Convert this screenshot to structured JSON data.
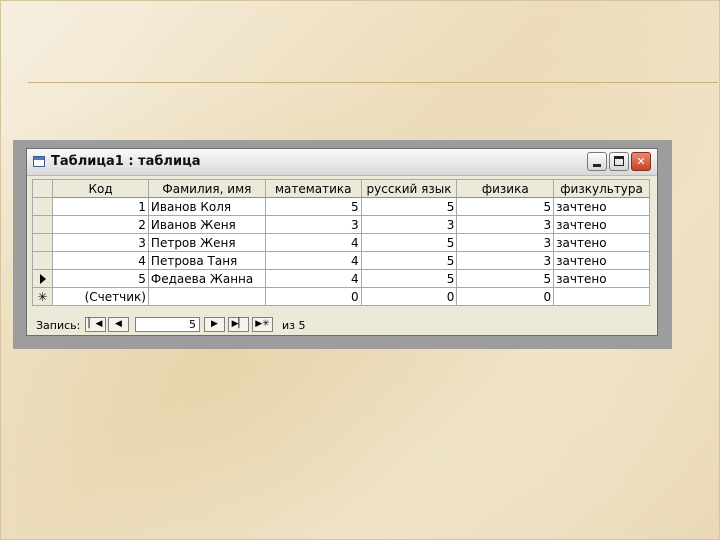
{
  "window": {
    "title": "Таблица1 : таблица",
    "close_glyph": "✕"
  },
  "table": {
    "columns": [
      "Код",
      "Фамилия, имя",
      "математика",
      "русский язык",
      "физика",
      "физкультура"
    ],
    "rows": [
      {
        "code": "1",
        "name": "Иванов Коля",
        "math": "5",
        "russian": "5",
        "physics": "5",
        "pe": "зачтено"
      },
      {
        "code": "2",
        "name": "Иванов Женя",
        "math": "3",
        "russian": "3",
        "physics": "3",
        "pe": "зачтено"
      },
      {
        "code": "3",
        "name": "Петров Женя",
        "math": "4",
        "russian": "5",
        "physics": "3",
        "pe": "зачтено"
      },
      {
        "code": "4",
        "name": "Петрова Таня",
        "math": "4",
        "russian": "5",
        "physics": "3",
        "pe": "зачтено"
      },
      {
        "code": "5",
        "name": "Федаева Жанна",
        "math": "4",
        "russian": "5",
        "physics": "5",
        "pe": "зачтено"
      }
    ],
    "new_row": {
      "code": "(Счетчик)",
      "name": "",
      "math": "0",
      "russian": "0",
      "physics": "0",
      "pe": ""
    },
    "current_row_marker": "record-pointer-icon",
    "new_row_marker": "✳"
  },
  "navigation": {
    "label": "Запись:",
    "current_record": "5",
    "of_label": "из 5",
    "buttons": {
      "first": "▏◀",
      "prev": "◀",
      "next": "▶",
      "last": "▶▏",
      "new": "▶✳"
    }
  }
}
